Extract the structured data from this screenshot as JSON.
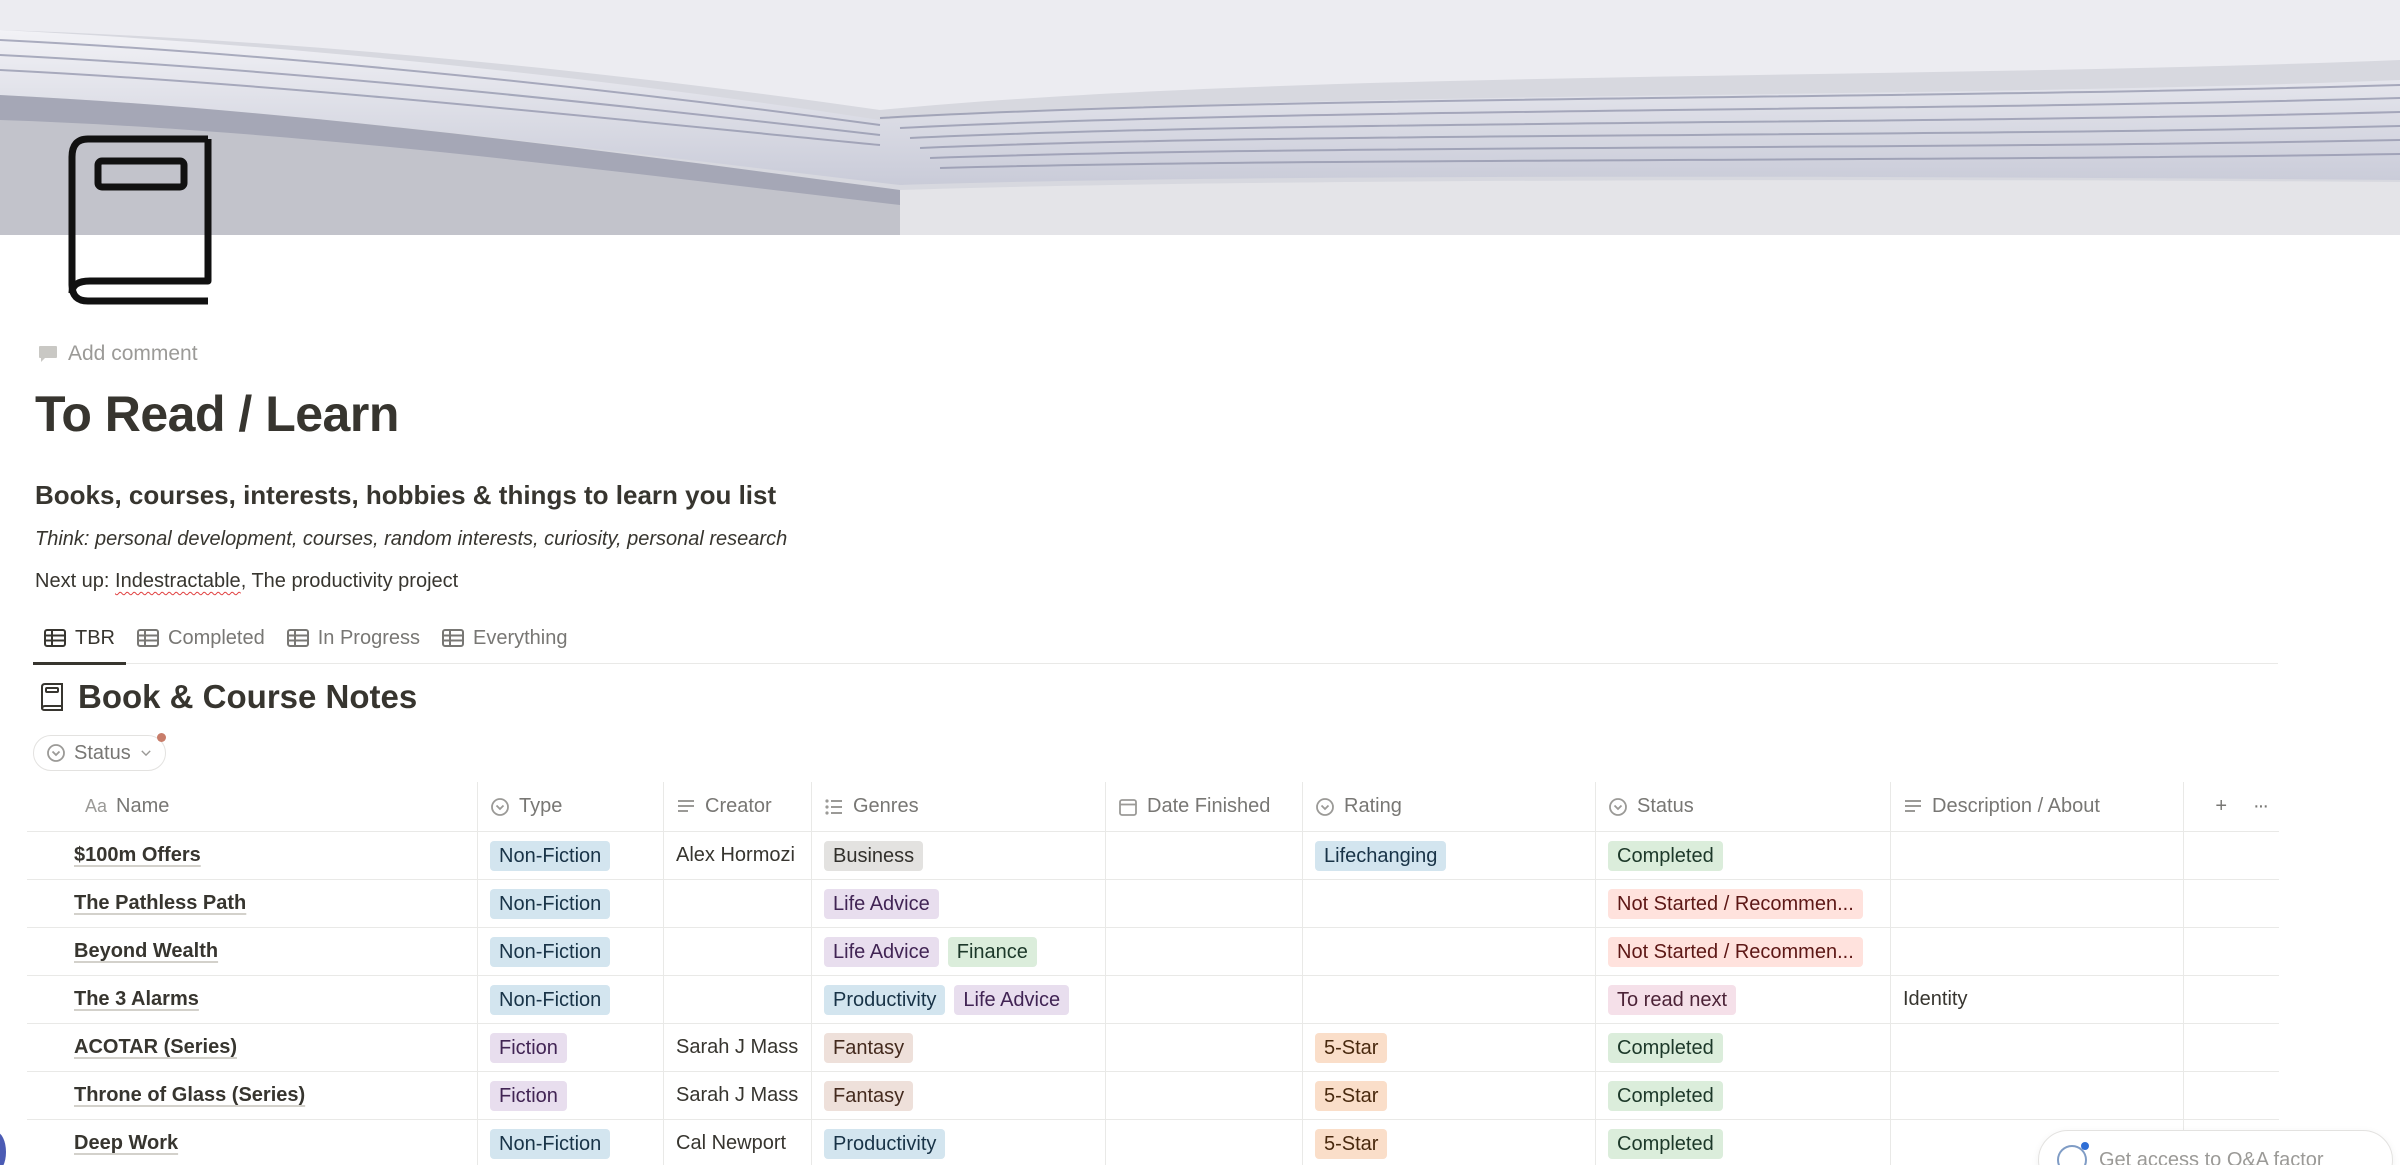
{
  "page": {
    "add_comment": "Add comment",
    "title": "To Read / Learn",
    "subheading": "Books, courses, interests, hobbies & things to learn you list",
    "italic_note": "Think: personal development, courses, random interests, curiosity, personal research",
    "next_up_prefix": "Next up: ",
    "next_up_link": "Indestractable",
    "next_up_rest": ", The productivity project"
  },
  "tabs": [
    {
      "label": "TBR",
      "active": true
    },
    {
      "label": "Completed",
      "active": false
    },
    {
      "label": "In Progress",
      "active": false
    },
    {
      "label": "Everything",
      "active": false
    }
  ],
  "database": {
    "title": "Book & Course Notes",
    "filter_label": "Status"
  },
  "columns": {
    "name": "Name",
    "type": "Type",
    "creator": "Creator",
    "genres": "Genres",
    "date_finished": "Date Finished",
    "rating": "Rating",
    "status": "Status",
    "description": "Description / About",
    "add": "+",
    "more": "···"
  },
  "rows": [
    {
      "name": "$100m Offers",
      "type": "Non-Fiction",
      "creator": "Alex Hormozi",
      "genres": [
        "Business"
      ],
      "date_finished": "",
      "rating": "Lifechanging",
      "status": "Completed",
      "description": ""
    },
    {
      "name": "The Pathless Path",
      "type": "Non-Fiction",
      "creator": "",
      "genres": [
        "Life Advice"
      ],
      "date_finished": "",
      "rating": "",
      "status": "Not Started / Recommen...",
      "description": ""
    },
    {
      "name": "Beyond Wealth",
      "type": "Non-Fiction",
      "creator": "",
      "genres": [
        "Life Advice",
        "Finance"
      ],
      "date_finished": "",
      "rating": "",
      "status": "Not Started / Recommen...",
      "description": ""
    },
    {
      "name": "The 3 Alarms",
      "type": "Non-Fiction",
      "creator": "",
      "genres": [
        "Productivity",
        "Life Advice"
      ],
      "date_finished": "",
      "rating": "",
      "status": "To read next",
      "description": "Identity"
    },
    {
      "name": "ACOTAR (Series)",
      "type": "Fiction",
      "creator": "Sarah J Mass",
      "genres": [
        "Fantasy"
      ],
      "date_finished": "",
      "rating": "5-Star",
      "status": "Completed",
      "description": ""
    },
    {
      "name": "Throne of Glass (Series)",
      "type": "Fiction",
      "creator": "Sarah J Mass",
      "genres": [
        "Fantasy"
      ],
      "date_finished": "",
      "rating": "5-Star",
      "status": "Completed",
      "description": ""
    },
    {
      "name": "Deep Work",
      "type": "Non-Fiction",
      "creator": "Cal Newport",
      "genres": [
        "Productivity"
      ],
      "date_finished": "",
      "rating": "5-Star",
      "status": "Completed",
      "description": ""
    }
  ],
  "tag_colors": {
    "Non-Fiction": "t-blue",
    "Fiction": "t-purple",
    "Business": "t-gray",
    "Life Advice": "t-purple",
    "Finance": "t-green",
    "Productivity": "t-blue",
    "Fantasy": "t-brown",
    "Lifechanging": "t-blue",
    "5-Star": "t-orange",
    "Completed": "t-green",
    "Not Started / Recommen...": "t-red",
    "To read next": "t-pink"
  },
  "widget": {
    "label": "Get access to Q&A factor"
  }
}
